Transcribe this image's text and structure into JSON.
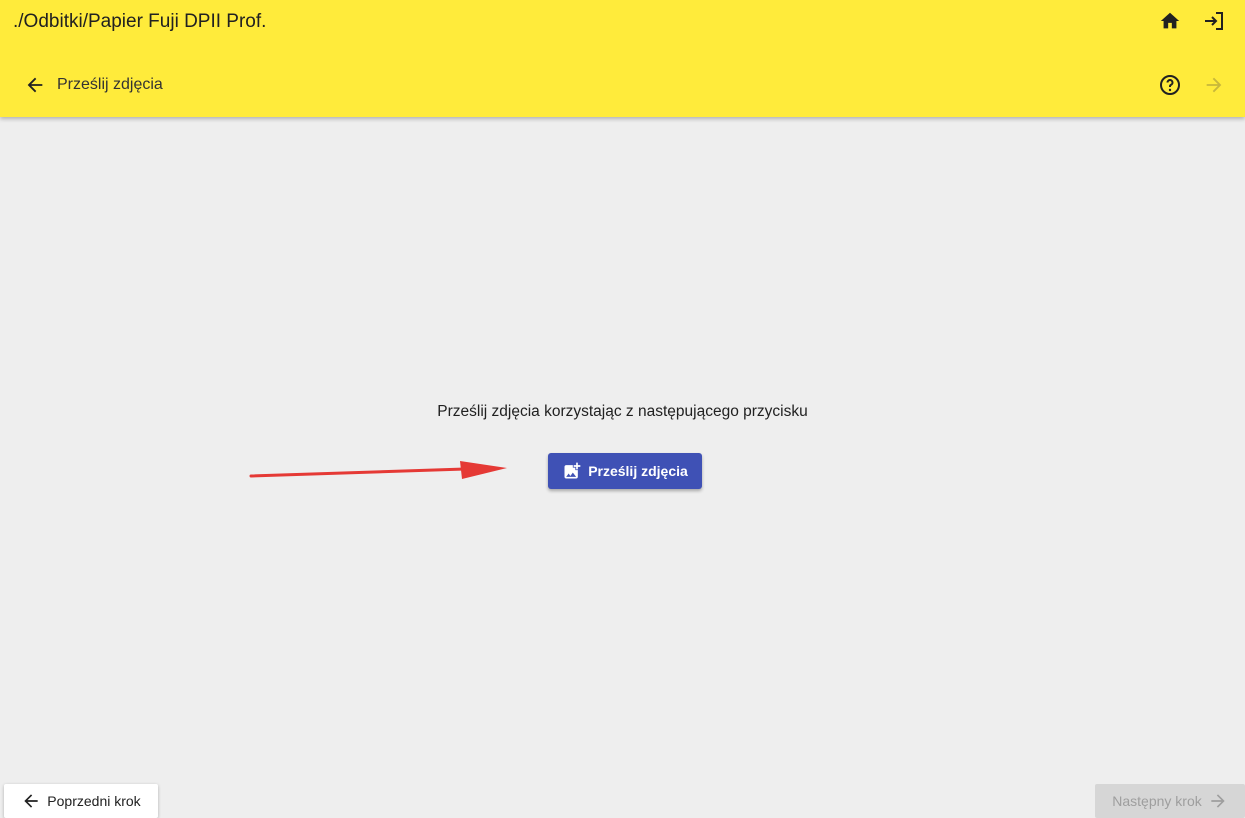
{
  "header": {
    "title": "./Odbitki/Papier Fuji DPII Prof.",
    "subtitle": "Prześlij zdjęcia",
    "home_icon": "home-icon",
    "logout_icon": "logout-icon",
    "back_icon": "arrow-left-icon",
    "help_icon": "help-circle-icon",
    "forward_icon": "arrow-right-icon"
  },
  "main": {
    "instruction": "Prześlij zdjęcia korzystając z następującego przycisku",
    "upload_button_label": "Prześlij zdjęcia",
    "upload_icon": "add-photo-icon"
  },
  "footer": {
    "prev_label": "Poprzedni krok",
    "next_label": "Następny krok"
  },
  "colors": {
    "header_bg": "#ffeb3b",
    "primary": "#3f51b5",
    "annotation_arrow": "#e53935",
    "page_bg": "#eeeeee"
  }
}
